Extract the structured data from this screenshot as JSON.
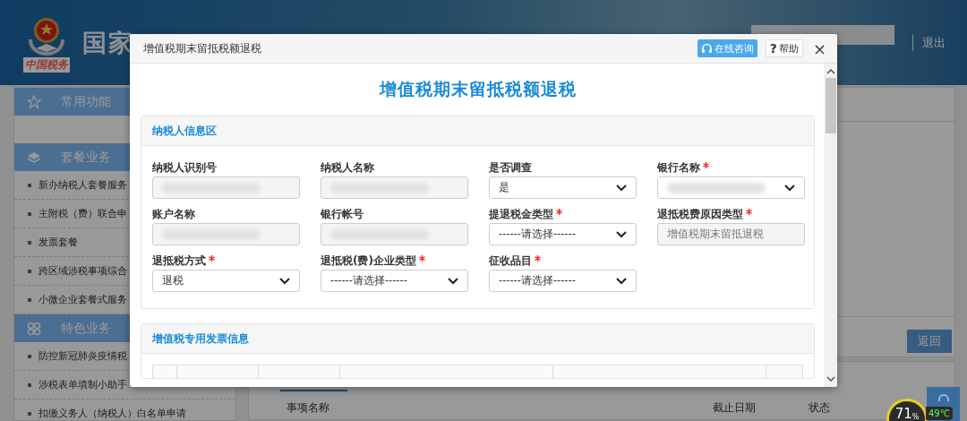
{
  "header": {
    "logo_caption": "中国税务",
    "title": "国家",
    "logout": "退出"
  },
  "sidebar": {
    "sections": [
      {
        "label": "常用功能"
      },
      {
        "label": "套餐业务",
        "items": [
          "新办纳税人套餐服务",
          "主附税（费）联合申",
          "发票套餐",
          "跨区域涉税事项综合",
          "小微企业套餐式服务"
        ]
      },
      {
        "label": "特色业务",
        "items": [
          "防控新冠肺炎疫情税",
          "涉税表单填制小助手",
          "扣缴义务人（纳税人）白名单申请"
        ]
      }
    ]
  },
  "main": {
    "return_button": "返回",
    "columns": [
      "事项名称",
      "截止日期",
      "状态"
    ]
  },
  "modal": {
    "title": "增值税期末留抵税额退税",
    "consult_button": "在线咨询",
    "help_button": "帮助",
    "help_mark": "?",
    "close": "×",
    "heading": "增值税期末留抵税额退税",
    "sections": [
      {
        "title": "纳税人信息区",
        "kind": "form",
        "fields": [
          {
            "label": "纳税人识别号",
            "required": false,
            "kind": "readonly",
            "redacted": true
          },
          {
            "label": "纳税人名称",
            "required": false,
            "kind": "readonly",
            "redacted": true
          },
          {
            "label": "是否调查",
            "required": false,
            "kind": "select",
            "value": "是"
          },
          {
            "label": "银行名称",
            "required": true,
            "kind": "select",
            "redacted": true
          },
          {
            "label": "账户名称",
            "required": false,
            "kind": "readonly",
            "redacted": true
          },
          {
            "label": "银行帐号",
            "required": false,
            "kind": "readonly",
            "redacted": true
          },
          {
            "label": "提退税金类型",
            "required": true,
            "kind": "select",
            "value": "------请选择------"
          },
          {
            "label": "退抵税费原因类型",
            "required": true,
            "kind": "readonly",
            "value": "增值税期末留抵退税"
          },
          {
            "label": "退抵税方式",
            "required": true,
            "kind": "select",
            "value": "退税"
          },
          {
            "label": "退抵税(费)企业类型",
            "required": true,
            "kind": "select",
            "value": "------请选择------"
          },
          {
            "label": "征收品目",
            "required": true,
            "kind": "select",
            "value": "------请选择------"
          }
        ]
      },
      {
        "title": "增值税专用发票信息",
        "kind": "table"
      }
    ]
  },
  "monitor": {
    "usage": "71",
    "unit": "%",
    "temperature": "49℃"
  }
}
